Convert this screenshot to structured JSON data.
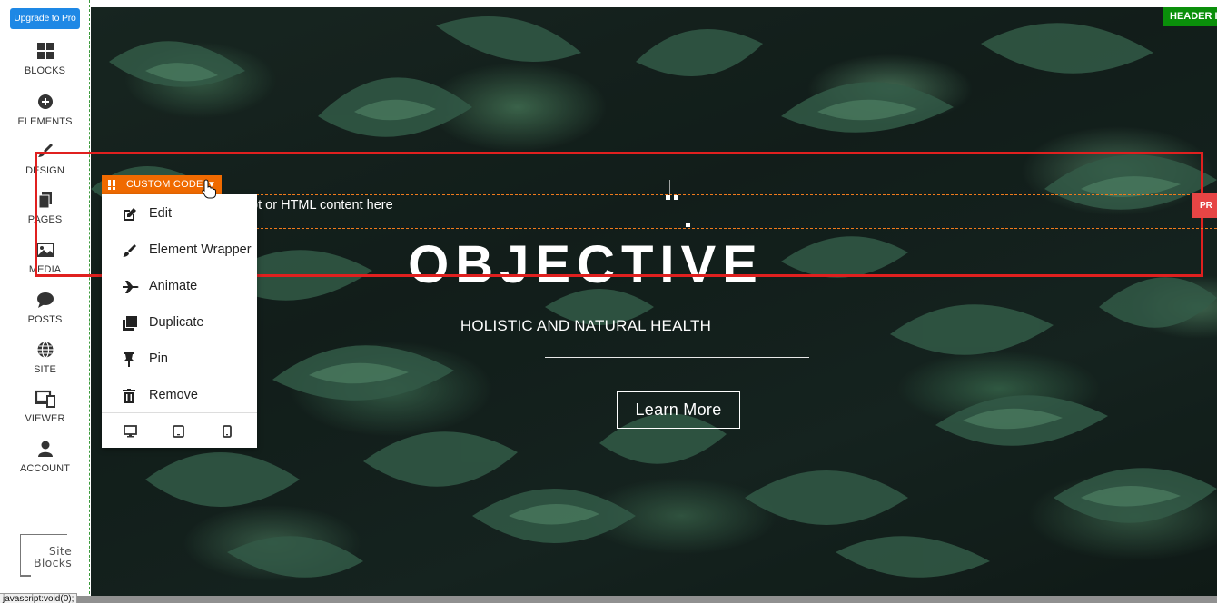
{
  "sidebar": {
    "upgrade_label": "Upgrade to Pro",
    "items": [
      {
        "label": "BLOCKS",
        "icon": "blocks-grid-icon"
      },
      {
        "label": "ELEMENTS",
        "icon": "plus-circle-icon"
      },
      {
        "label": "DESIGN",
        "icon": "brush-icon"
      },
      {
        "label": "PAGES",
        "icon": "pages-copy-icon"
      },
      {
        "label": "MEDIA",
        "icon": "image-icon"
      },
      {
        "label": "POSTS",
        "icon": "comment-icon"
      },
      {
        "label": "SITE",
        "icon": "globe-icon"
      },
      {
        "label": "VIEWER",
        "icon": "devices-icon"
      },
      {
        "label": "ACCOUNT",
        "icon": "user-icon"
      }
    ],
    "logo_line1": "Site",
    "logo_line2": "Blocks"
  },
  "canvas": {
    "header_badge": "HEADER I",
    "hero_title": "OBJECTIVE",
    "hero_subtitle": "HOLISTIC AND NATURAL HEALTH",
    "button_label": "Learn More",
    "code_placeholder": "ript or HTML content here",
    "pro_tab": "PR"
  },
  "element_tag": {
    "label": "CUSTOM CODE",
    "caret": "▼"
  },
  "context_menu": {
    "items": [
      {
        "label": "Edit",
        "icon": "edit-pencil-icon"
      },
      {
        "label": "Element Wrapper",
        "icon": "brush-icon"
      },
      {
        "label": "Animate",
        "icon": "plane-icon"
      },
      {
        "label": "Duplicate",
        "icon": "duplicate-icon"
      },
      {
        "label": "Pin",
        "icon": "pin-icon"
      },
      {
        "label": "Remove",
        "icon": "trash-icon"
      }
    ],
    "devices": [
      "desktop-icon",
      "tablet-icon",
      "mobile-icon"
    ]
  },
  "status_bar": {
    "url_text": "javascript:void(0);"
  },
  "colors": {
    "upgrade_blue": "#1e88e5",
    "select_red": "#e0201f",
    "tag_orange": "#f06a00",
    "header_green": "#0a8f0a"
  }
}
